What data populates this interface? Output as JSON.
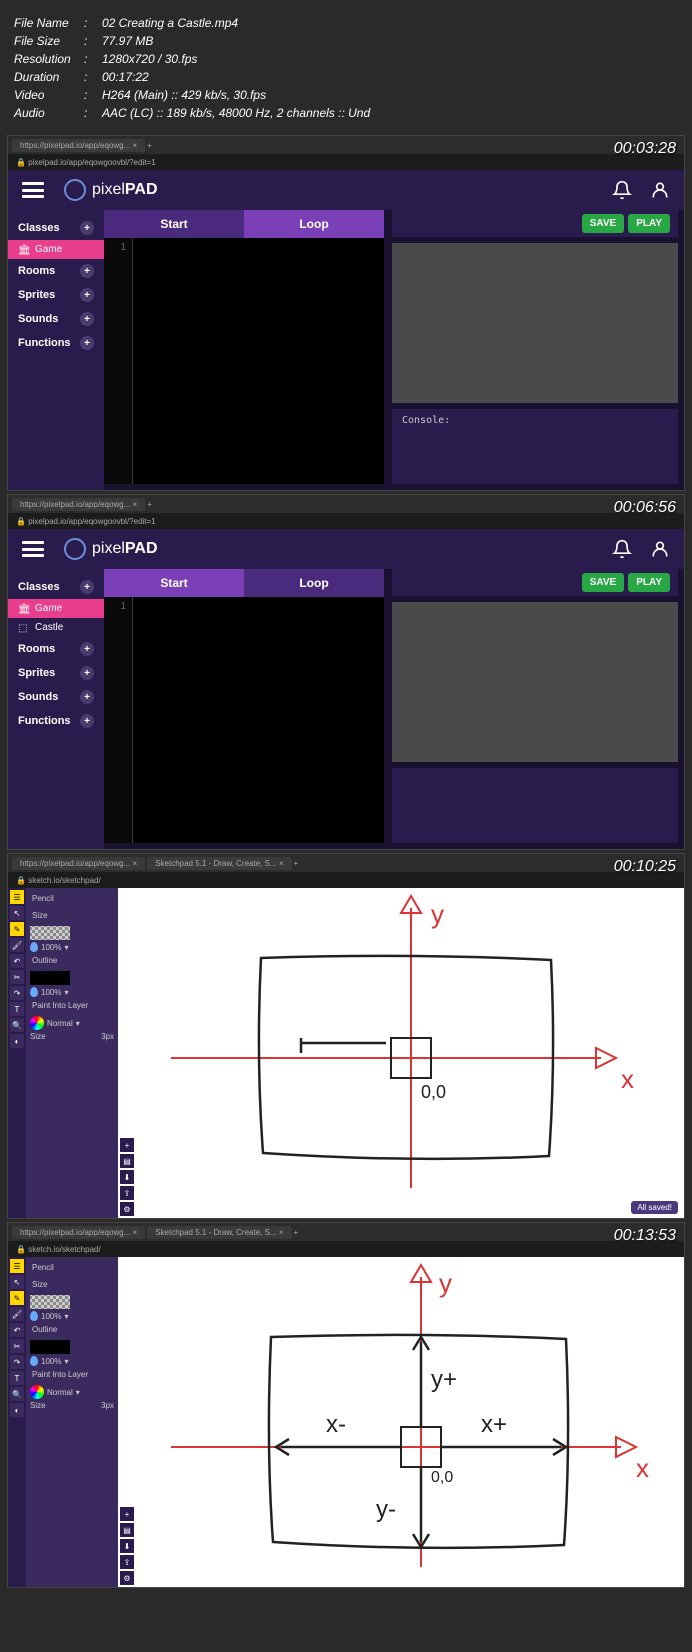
{
  "metadata": {
    "filename_label": "File Name",
    "filename": "02 Creating a Castle.mp4",
    "filesize_label": "File Size",
    "filesize": "77.97 MB",
    "resolution_label": "Resolution",
    "resolution": "1280x720 / 30.fps",
    "duration_label": "Duration",
    "duration": "00:17:22",
    "video_label": "Video",
    "video": "H264 (Main) :: 429 kb/s, 30.fps",
    "audio_label": "Audio",
    "audio": "AAC (LC) :: 189 kb/s, 48000 Hz, 2 channels :: Und",
    "sep": ":"
  },
  "shots": [
    {
      "timestamp": "00:03:28",
      "url": "pixelpad.io/app/eqowgoovbl/?edit=1",
      "tab": "https://pixelpad.io/app/eqowg... ×",
      "app": "pixelpad",
      "logo_text": "pixel",
      "logo_bold": "PAD",
      "sidebar": {
        "classes": "Classes",
        "game": "Game",
        "rooms": "Rooms",
        "sprites": "Sprites",
        "sounds": "Sounds",
        "functions": "Functions"
      },
      "tabs": {
        "start": "Start",
        "loop": "Loop",
        "active": "loop"
      },
      "line": "1",
      "save": "SAVE",
      "play": "PLAY",
      "console": "Console:"
    },
    {
      "timestamp": "00:06:56",
      "url": "pixelpad.io/app/eqowgoovbl/?edit=1",
      "tab": "https://pixelpad.io/app/eqowg... ×",
      "app": "pixelpad",
      "logo_text": "pixel",
      "logo_bold": "PAD",
      "sidebar": {
        "classes": "Classes",
        "game": "Game",
        "castle": "Castle",
        "rooms": "Rooms",
        "sprites": "Sprites",
        "sounds": "Sounds",
        "functions": "Functions"
      },
      "tabs": {
        "start": "Start",
        "loop": "Loop",
        "active": "start"
      },
      "line": "1",
      "save": "SAVE",
      "play": "PLAY"
    },
    {
      "timestamp": "00:10:25",
      "url": "sketch.io/sketchpad/",
      "tab1": "https://pixelpad.io/app/eqowg... ×",
      "tab2": "Sketchpad 5.1 - Draw, Create, S... ×",
      "app": "sketchpad",
      "panel": {
        "tool": "Pencil",
        "size_label": "Size",
        "outline": "Outline",
        "opacity": "100%",
        "paint_layer": "Paint Into Layer",
        "blend": "Normal",
        "size_val": "3px"
      },
      "drawing": {
        "axes": [
          "x",
          "y"
        ],
        "origin": "0,0"
      },
      "saved": "All saved!"
    },
    {
      "timestamp": "00:13:53",
      "url": "sketch.io/sketchpad/",
      "tab1": "https://pixelpad.io/app/eqowg... ×",
      "tab2": "Sketchpad 5.1 - Draw, Create, S... ×",
      "app": "sketchpad",
      "panel": {
        "tool": "Pencil",
        "size_label": "Size",
        "outline": "Outline",
        "opacity": "100%",
        "paint_layer": "Paint Into Layer",
        "blend": "Normal",
        "size_val": "3px"
      },
      "drawing": {
        "axes": [
          "x",
          "y"
        ],
        "origin": "0,0",
        "labels": [
          "x-",
          "x+",
          "y+",
          "y-"
        ]
      }
    }
  ]
}
